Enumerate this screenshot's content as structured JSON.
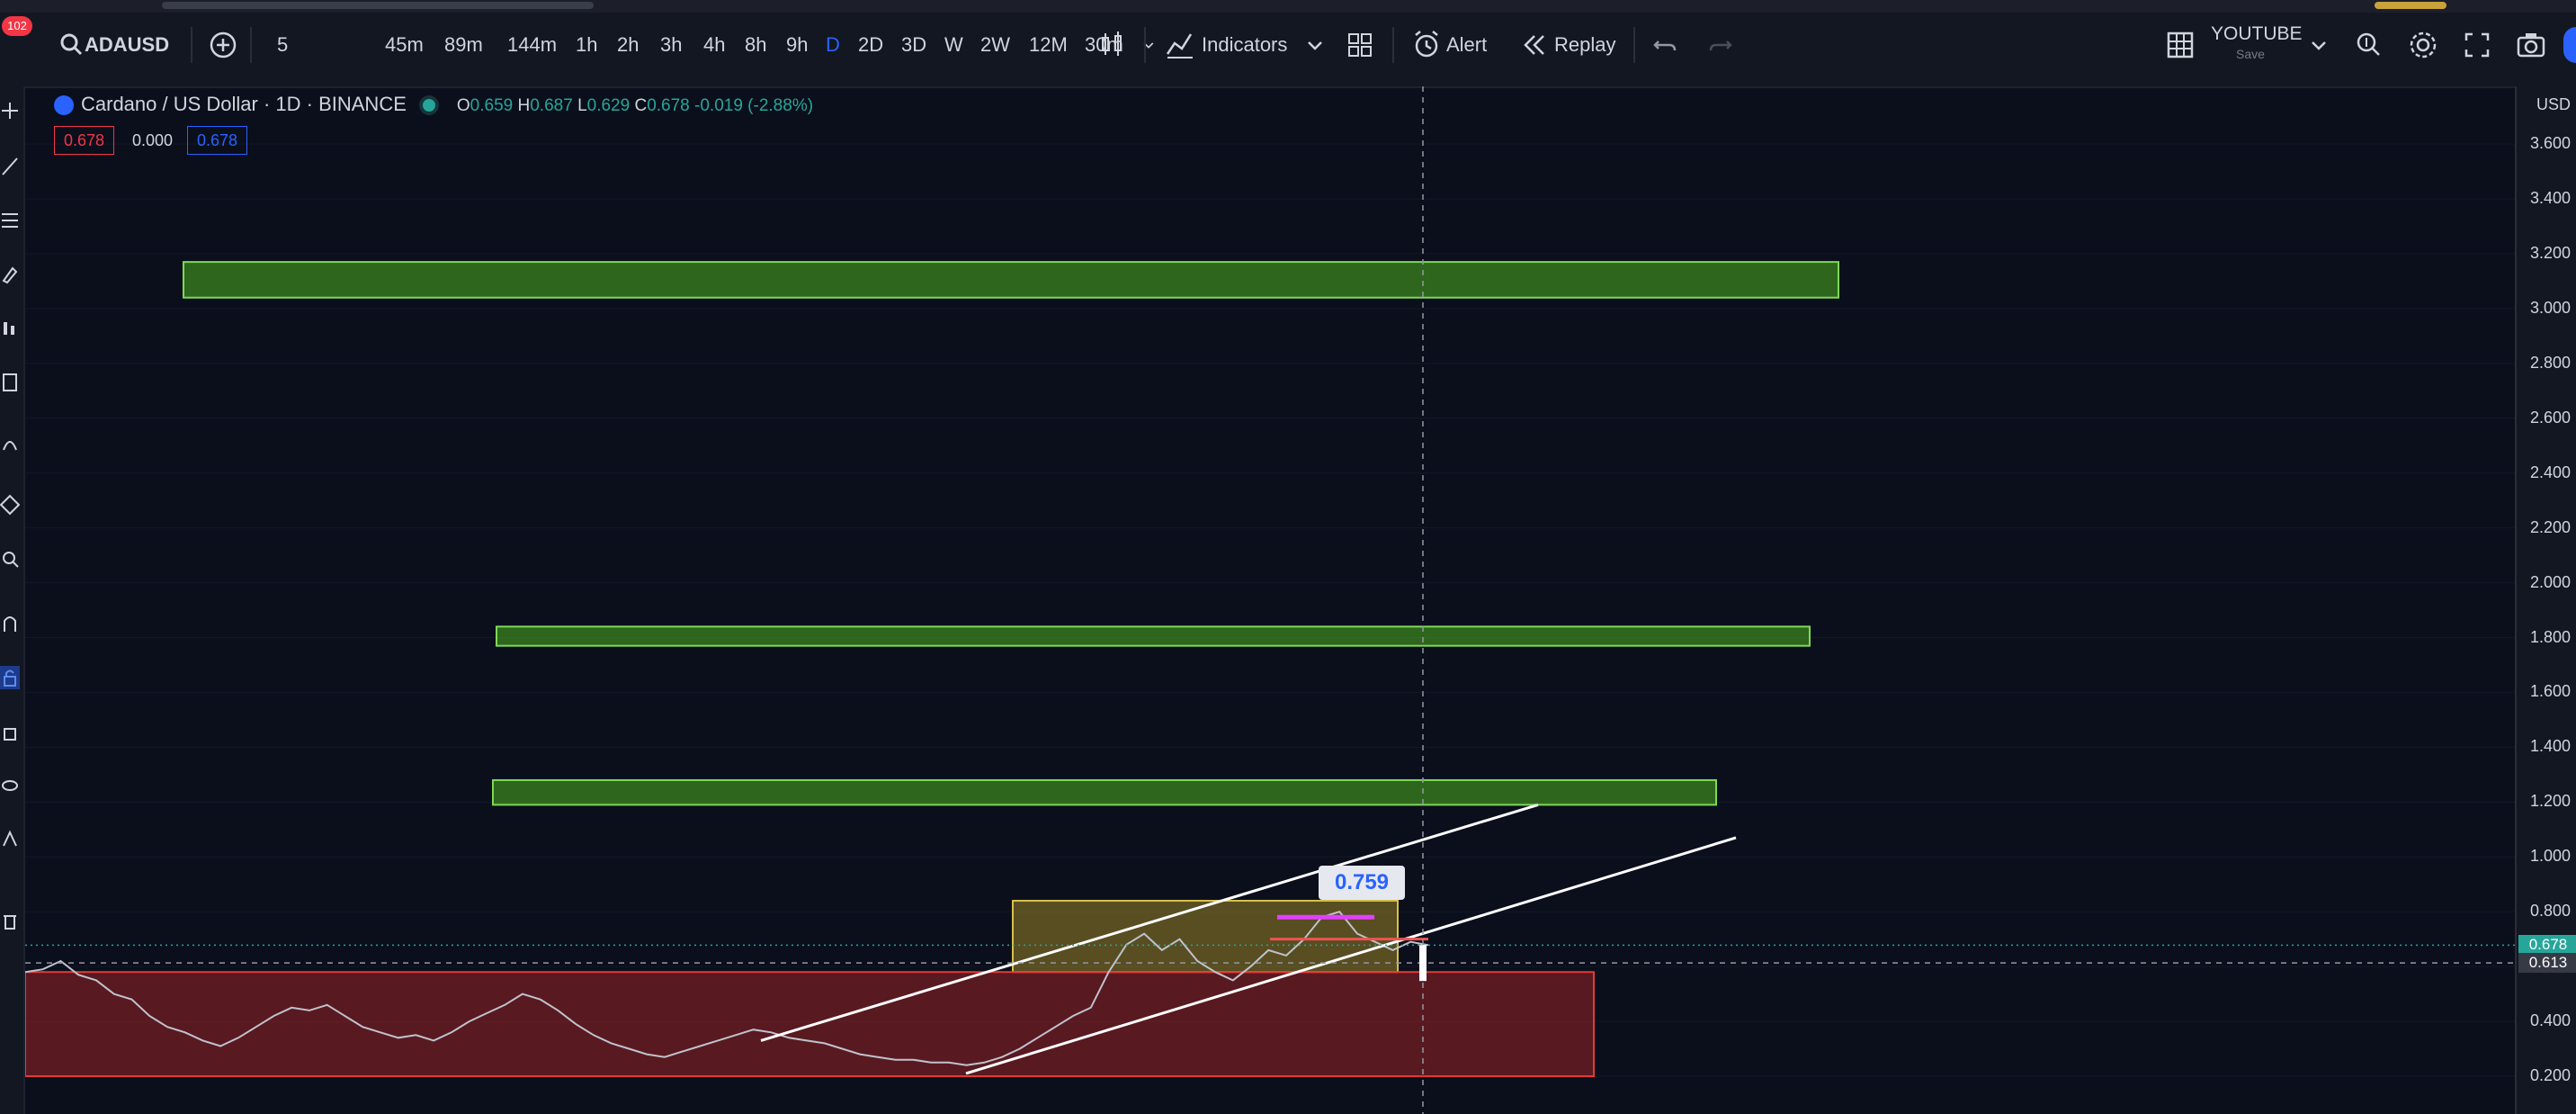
{
  "notification_badge": "102",
  "toolbar": {
    "symbol": "ADAUSD",
    "intervals": [
      "5",
      "45m",
      "89m",
      "144m",
      "1h",
      "2h",
      "3h",
      "4h",
      "8h",
      "9h",
      "D",
      "2D",
      "3D",
      "W",
      "2W",
      "12M",
      "30m"
    ],
    "active_interval": "D",
    "indicators_label": "Indicators",
    "alert_label": "Alert",
    "replay_label": "Replay",
    "layout_name": "YOUTUBE",
    "layout_sub": "Save"
  },
  "legend": {
    "title": "Cardano / US Dollar · 1D · BINANCE",
    "open_label": "O",
    "open": "0.659",
    "high_label": "H",
    "high": "0.687",
    "low_label": "L",
    "low": "0.629",
    "close_label": "C",
    "close": "0.678",
    "change": "-0.019 (-2.88%)",
    "bid": "0.678",
    "spread": "0.000",
    "ask": "0.678"
  },
  "price_scale": {
    "currency": "USD",
    "current_price_label": "0.678",
    "crosshair_price_label": "0.613"
  },
  "callout_value": "0.759",
  "icons": [
    "search-icon",
    "add-symbol-icon",
    "candles-icon",
    "indicators-icon",
    "templates-icon",
    "alert-icon",
    "replay-icon",
    "undo-icon",
    "redo-icon",
    "layout-grid-icon",
    "chevron-down-icon",
    "quick-search-icon",
    "settings-icon",
    "fullscreen-icon",
    "camera-icon"
  ],
  "colors": {
    "background": "#0b0f1c",
    "resistance_zone": "#4caf1f",
    "support_zone": "#c62828",
    "consolidation_zone": "#b59b2a",
    "active_interval": "#2962ff"
  },
  "chart_data": {
    "type": "line",
    "symbol": "ADAUSD",
    "ylim": [
      0.1,
      3.75
    ],
    "y_ticks": [
      0.2,
      0.4,
      0.6,
      0.8,
      1.0,
      1.2,
      1.4,
      1.6,
      1.8,
      2.0,
      2.2,
      2.4,
      2.6,
      2.8,
      3.0,
      3.2,
      3.4,
      3.6
    ],
    "price_series": [
      0.58,
      0.59,
      0.62,
      0.57,
      0.55,
      0.5,
      0.48,
      0.42,
      0.38,
      0.36,
      0.33,
      0.31,
      0.34,
      0.38,
      0.42,
      0.45,
      0.44,
      0.46,
      0.42,
      0.38,
      0.36,
      0.34,
      0.35,
      0.33,
      0.36,
      0.4,
      0.43,
      0.46,
      0.5,
      0.48,
      0.44,
      0.39,
      0.35,
      0.32,
      0.3,
      0.28,
      0.27,
      0.29,
      0.31,
      0.33,
      0.35,
      0.37,
      0.36,
      0.34,
      0.33,
      0.32,
      0.3,
      0.28,
      0.27,
      0.26,
      0.26,
      0.25,
      0.25,
      0.24,
      0.25,
      0.27,
      0.3,
      0.34,
      0.38,
      0.42,
      0.45,
      0.58,
      0.68,
      0.72,
      0.66,
      0.7,
      0.62,
      0.58,
      0.55,
      0.6,
      0.66,
      0.64,
      0.7,
      0.78,
      0.8,
      0.72,
      0.69,
      0.66,
      0.69,
      0.678
    ],
    "zones": [
      {
        "kind": "resistance",
        "low": 3.04,
        "high": 3.17
      },
      {
        "kind": "resistance",
        "low": 1.77,
        "high": 1.84
      },
      {
        "kind": "resistance",
        "low": 1.19,
        "high": 1.28
      },
      {
        "kind": "consolidation",
        "low": 0.58,
        "high": 0.84
      },
      {
        "kind": "support",
        "low": 0.2,
        "high": 0.58
      }
    ],
    "channel_lines": [
      {
        "name": "upper",
        "from": 0.33,
        "to": 1.19
      },
      {
        "name": "lower",
        "from": 0.21,
        "to": 1.07
      }
    ],
    "crosshair_price": 0.613,
    "last_price": 0.678
  }
}
